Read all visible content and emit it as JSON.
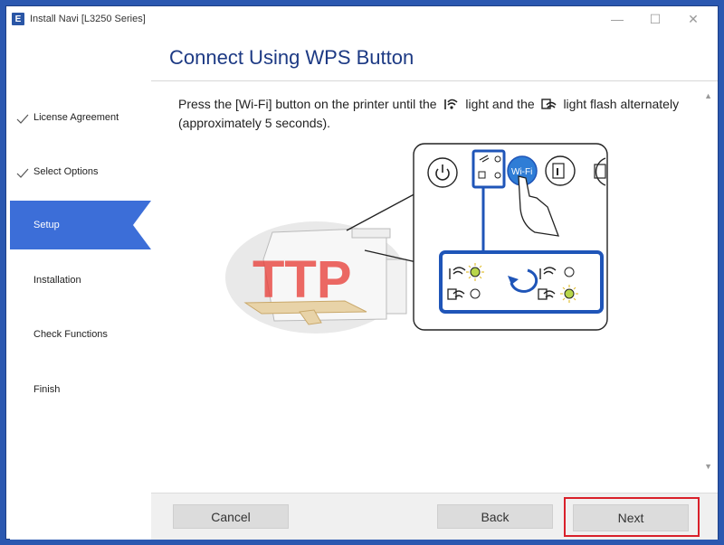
{
  "window": {
    "title": "Install Navi [L3250 Series]",
    "app_icon": "E",
    "buttons": {
      "minimize": "—",
      "maximize": "☐",
      "close": "✕"
    }
  },
  "sidebar": {
    "steps": [
      {
        "label": "License Agreement",
        "state": "done"
      },
      {
        "label": "Select Options",
        "state": "done"
      },
      {
        "label": "Setup",
        "state": "active"
      },
      {
        "label": "Installation",
        "state": "pending"
      },
      {
        "label": "Check Functions",
        "state": "pending"
      },
      {
        "label": "Finish",
        "state": "pending"
      }
    ]
  },
  "main": {
    "title": "Connect Using WPS Button",
    "instruction_part1": "Press the [Wi-Fi] button on the printer until the",
    "instruction_part2": "light and the",
    "instruction_part3": "light flash alternately (approximately 5 seconds).",
    "illustration": {
      "wifi_button_label": "Wi-Fi",
      "watermark": "TTP"
    }
  },
  "footer": {
    "cancel_label": "Cancel",
    "back_label": "Back",
    "next_label": "Next"
  },
  "colors": {
    "accent": "#3c6ed8",
    "title": "#1d3a84",
    "panel_blue": "#1f55b8",
    "highlight_red": "#d9202a",
    "led_green": "#b8d64a"
  }
}
